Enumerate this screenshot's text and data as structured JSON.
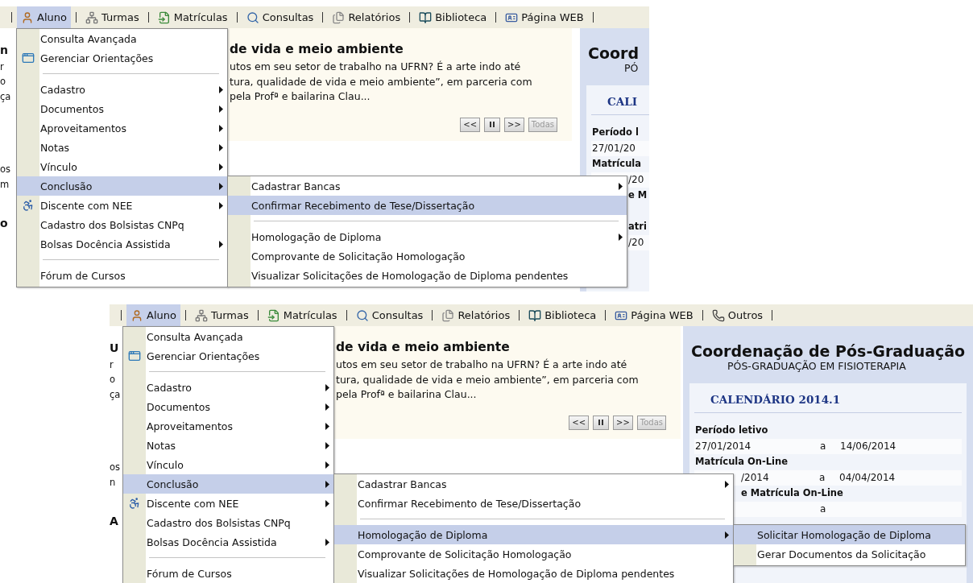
{
  "screenshots": [
    {
      "menubar": {
        "items": [
          {
            "label": "Aluno",
            "selected": true
          },
          {
            "label": "Turmas",
            "selected": false
          },
          {
            "label": "Matrículas",
            "selected": false
          },
          {
            "label": "Consultas",
            "selected": false
          },
          {
            "label": "Relatórios",
            "selected": false
          },
          {
            "label": "Biblioteca",
            "selected": false
          },
          {
            "label": "Página WEB",
            "selected": false
          }
        ]
      },
      "left_fragments": [
        [
          {
            "text": "n",
            "kind": "title"
          },
          {
            "text": "r",
            "kind": "text"
          },
          {
            "text": "o",
            "kind": "text"
          },
          {
            "text": "ça",
            "kind": "text"
          }
        ],
        [
          {
            "text": "os",
            "kind": "text"
          },
          {
            "text": "m",
            "kind": "text"
          }
        ],
        [
          {
            "text": "o",
            "kind": "title"
          }
        ]
      ],
      "news": {
        "title": "de vida e meio ambiente",
        "lines": [
          "utos em seu setor de trabalho na UFRN? É a arte indo até",
          "tura, qualidade de vida e meio ambiente”, em parceria com",
          "pela Profª e bailarina Clau..."
        ],
        "buttons": [
          {
            "kind": "text",
            "label": "<<",
            "disabled": false
          },
          {
            "kind": "pause",
            "disabled": false
          },
          {
            "kind": "text",
            "label": ">>",
            "disabled": false
          },
          {
            "kind": "text",
            "label": "Todas",
            "disabled": true
          }
        ]
      },
      "coordination": {
        "title": "Coord",
        "subtitle": "PÓ",
        "calendar": {
          "heading": "CALI",
          "rows": [
            {
              "kind": "label",
              "text": "Período l",
              "clipped": false
            },
            {
              "kind": "dates",
              "from": "27/01/20",
              "clipped": false
            },
            {
              "kind": "label",
              "text": "Matrícula",
              "clipped": false
            },
            {
              "kind": "dates",
              "from": "/20",
              "clipped": true
            },
            {
              "kind": "label",
              "text": "e M",
              "clipped": true
            },
            {
              "kind": "spacer"
            },
            {
              "kind": "label",
              "text": "atri",
              "clipped": true
            },
            {
              "kind": "dates",
              "from": "/20",
              "clipped": true
            }
          ]
        }
      },
      "menu": {
        "items": [
          {
            "kind": "item",
            "label": "Consulta Avançada",
            "has_submenu": false,
            "selected": false
          },
          {
            "kind": "item",
            "label": "Gerenciar Orientações",
            "has_submenu": false,
            "selected": false
          },
          {
            "kind": "separator"
          },
          {
            "kind": "item",
            "label": "Cadastro",
            "has_submenu": true,
            "selected": false
          },
          {
            "kind": "item",
            "label": "Documentos",
            "has_submenu": true,
            "selected": false
          },
          {
            "kind": "item",
            "label": "Aproveitamentos",
            "has_submenu": true,
            "selected": false
          },
          {
            "kind": "item",
            "label": "Notas",
            "has_submenu": true,
            "selected": false
          },
          {
            "kind": "item",
            "label": "Vínculo",
            "has_submenu": true,
            "selected": false
          },
          {
            "kind": "item",
            "label": "Conclusão",
            "has_submenu": true,
            "selected": true,
            "children": [
              {
                "kind": "item",
                "label": "Cadastrar Bancas",
                "has_submenu": true,
                "selected": false
              },
              {
                "kind": "item",
                "label": "Confirmar Recebimento de Tese/Dissertação",
                "has_submenu": false,
                "selected": true
              },
              {
                "kind": "separator"
              },
              {
                "kind": "item",
                "label": "Homologação de Diploma",
                "has_submenu": true,
                "selected": false
              },
              {
                "kind": "item",
                "label": "Comprovante de Solicitação Homologação",
                "has_submenu": false,
                "selected": false
              },
              {
                "kind": "item",
                "label": "Visualizar Solicitações de Homologação de Diploma pendentes",
                "has_submenu": false,
                "selected": false
              }
            ]
          },
          {
            "kind": "item",
            "label": "Discente com NEE",
            "has_submenu": true,
            "selected": false
          },
          {
            "kind": "item",
            "label": "Cadastro dos Bolsistas CNPq",
            "has_submenu": false,
            "selected": false
          },
          {
            "kind": "item",
            "label": "Bolsas Docência Assistida",
            "has_submenu": true,
            "selected": false
          },
          {
            "kind": "separator"
          },
          {
            "kind": "item",
            "label": "Fórum de Cursos",
            "has_submenu": false,
            "selected": false
          }
        ]
      }
    },
    {
      "menubar": {
        "items": [
          {
            "label": "Aluno",
            "selected": true
          },
          {
            "label": "Turmas",
            "selected": false
          },
          {
            "label": "Matrículas",
            "selected": false
          },
          {
            "label": "Consultas",
            "selected": false
          },
          {
            "label": "Relatórios",
            "selected": false
          },
          {
            "label": "Biblioteca",
            "selected": false
          },
          {
            "label": "Página WEB",
            "selected": false
          },
          {
            "label": "Outros",
            "selected": false
          }
        ]
      },
      "left_fragments": [
        [
          {
            "text": "U",
            "kind": "title"
          },
          {
            "text": "r",
            "kind": "text"
          },
          {
            "text": "o",
            "kind": "text"
          },
          {
            "text": "ça",
            "kind": "text"
          }
        ],
        [
          {
            "text": "os",
            "kind": "text"
          },
          {
            "text": "n",
            "kind": "text"
          }
        ],
        [
          {
            "text": "A",
            "kind": "title"
          }
        ]
      ],
      "news": {
        "title": "de vida e meio ambiente",
        "lines": [
          "utos em seu setor de trabalho na UFRN? É a arte indo até",
          "tura, qualidade de vida e meio ambiente”, em parceria com",
          "pela Profª e bailarina Clau..."
        ],
        "buttons": [
          {
            "kind": "text",
            "label": "<<",
            "disabled": false
          },
          {
            "kind": "pause",
            "disabled": false
          },
          {
            "kind": "text",
            "label": ">>",
            "disabled": false
          },
          {
            "kind": "text",
            "label": "Todas",
            "disabled": true
          }
        ]
      },
      "coordination": {
        "title": "Coordenação de Pós-Graduação",
        "subtitle": "PÓS-GRADUAÇÃO EM FISIOTERAPIA",
        "calendar": {
          "heading": "CALENDÁRIO 2014.1",
          "rows": [
            {
              "kind": "label",
              "text": "Período letivo",
              "clipped": false
            },
            {
              "kind": "dates",
              "from": "27/01/2014",
              "sep": "a",
              "to": "14/06/2014",
              "clipped": false
            },
            {
              "kind": "label",
              "text": "Matrícula On-Line",
              "clipped": false
            },
            {
              "kind": "dates",
              "from": "/2014",
              "sep": "a",
              "to": "04/04/2014",
              "clipped": true
            },
            {
              "kind": "label",
              "text": "e Matrícula On-Line",
              "clipped": true
            },
            {
              "kind": "dates",
              "sep": "a",
              "clipped": false
            }
          ]
        }
      },
      "menu": {
        "items": [
          {
            "kind": "item",
            "label": "Consulta Avançada",
            "has_submenu": false,
            "selected": false
          },
          {
            "kind": "item",
            "label": "Gerenciar Orientações",
            "has_submenu": false,
            "selected": false
          },
          {
            "kind": "separator"
          },
          {
            "kind": "item",
            "label": "Cadastro",
            "has_submenu": true,
            "selected": false
          },
          {
            "kind": "item",
            "label": "Documentos",
            "has_submenu": true,
            "selected": false
          },
          {
            "kind": "item",
            "label": "Aproveitamentos",
            "has_submenu": true,
            "selected": false
          },
          {
            "kind": "item",
            "label": "Notas",
            "has_submenu": true,
            "selected": false
          },
          {
            "kind": "item",
            "label": "Vínculo",
            "has_submenu": true,
            "selected": false
          },
          {
            "kind": "item",
            "label": "Conclusão",
            "has_submenu": true,
            "selected": true,
            "children": [
              {
                "kind": "item",
                "label": "Cadastrar Bancas",
                "has_submenu": true,
                "selected": false
              },
              {
                "kind": "item",
                "label": "Confirmar Recebimento de Tese/Dissertação",
                "has_submenu": false,
                "selected": false
              },
              {
                "kind": "separator"
              },
              {
                "kind": "item",
                "label": "Homologação de Diploma",
                "has_submenu": true,
                "selected": true,
                "children": [
                  {
                    "kind": "item",
                    "label": "Solicitar Homologação de Diploma",
                    "has_submenu": false,
                    "selected": true
                  },
                  {
                    "kind": "item",
                    "label": "Gerar Documentos da Solicitação",
                    "has_submenu": false,
                    "selected": false
                  }
                ]
              },
              {
                "kind": "item",
                "label": "Comprovante de Solicitação Homologação",
                "has_submenu": false,
                "selected": false
              },
              {
                "kind": "item",
                "label": "Visualizar Solicitações de Homologação de Diploma pendentes",
                "has_submenu": false,
                "selected": false
              }
            ]
          },
          {
            "kind": "item",
            "label": "Discente com NEE",
            "has_submenu": true,
            "selected": false
          },
          {
            "kind": "item",
            "label": "Cadastro dos Bolsistas CNPq",
            "has_submenu": false,
            "selected": false
          },
          {
            "kind": "item",
            "label": "Bolsas Docência Assistida",
            "has_submenu": true,
            "selected": false
          },
          {
            "kind": "separator"
          },
          {
            "kind": "item",
            "label": "Fórum de Cursos",
            "has_submenu": false,
            "selected": false
          }
        ]
      }
    }
  ]
}
